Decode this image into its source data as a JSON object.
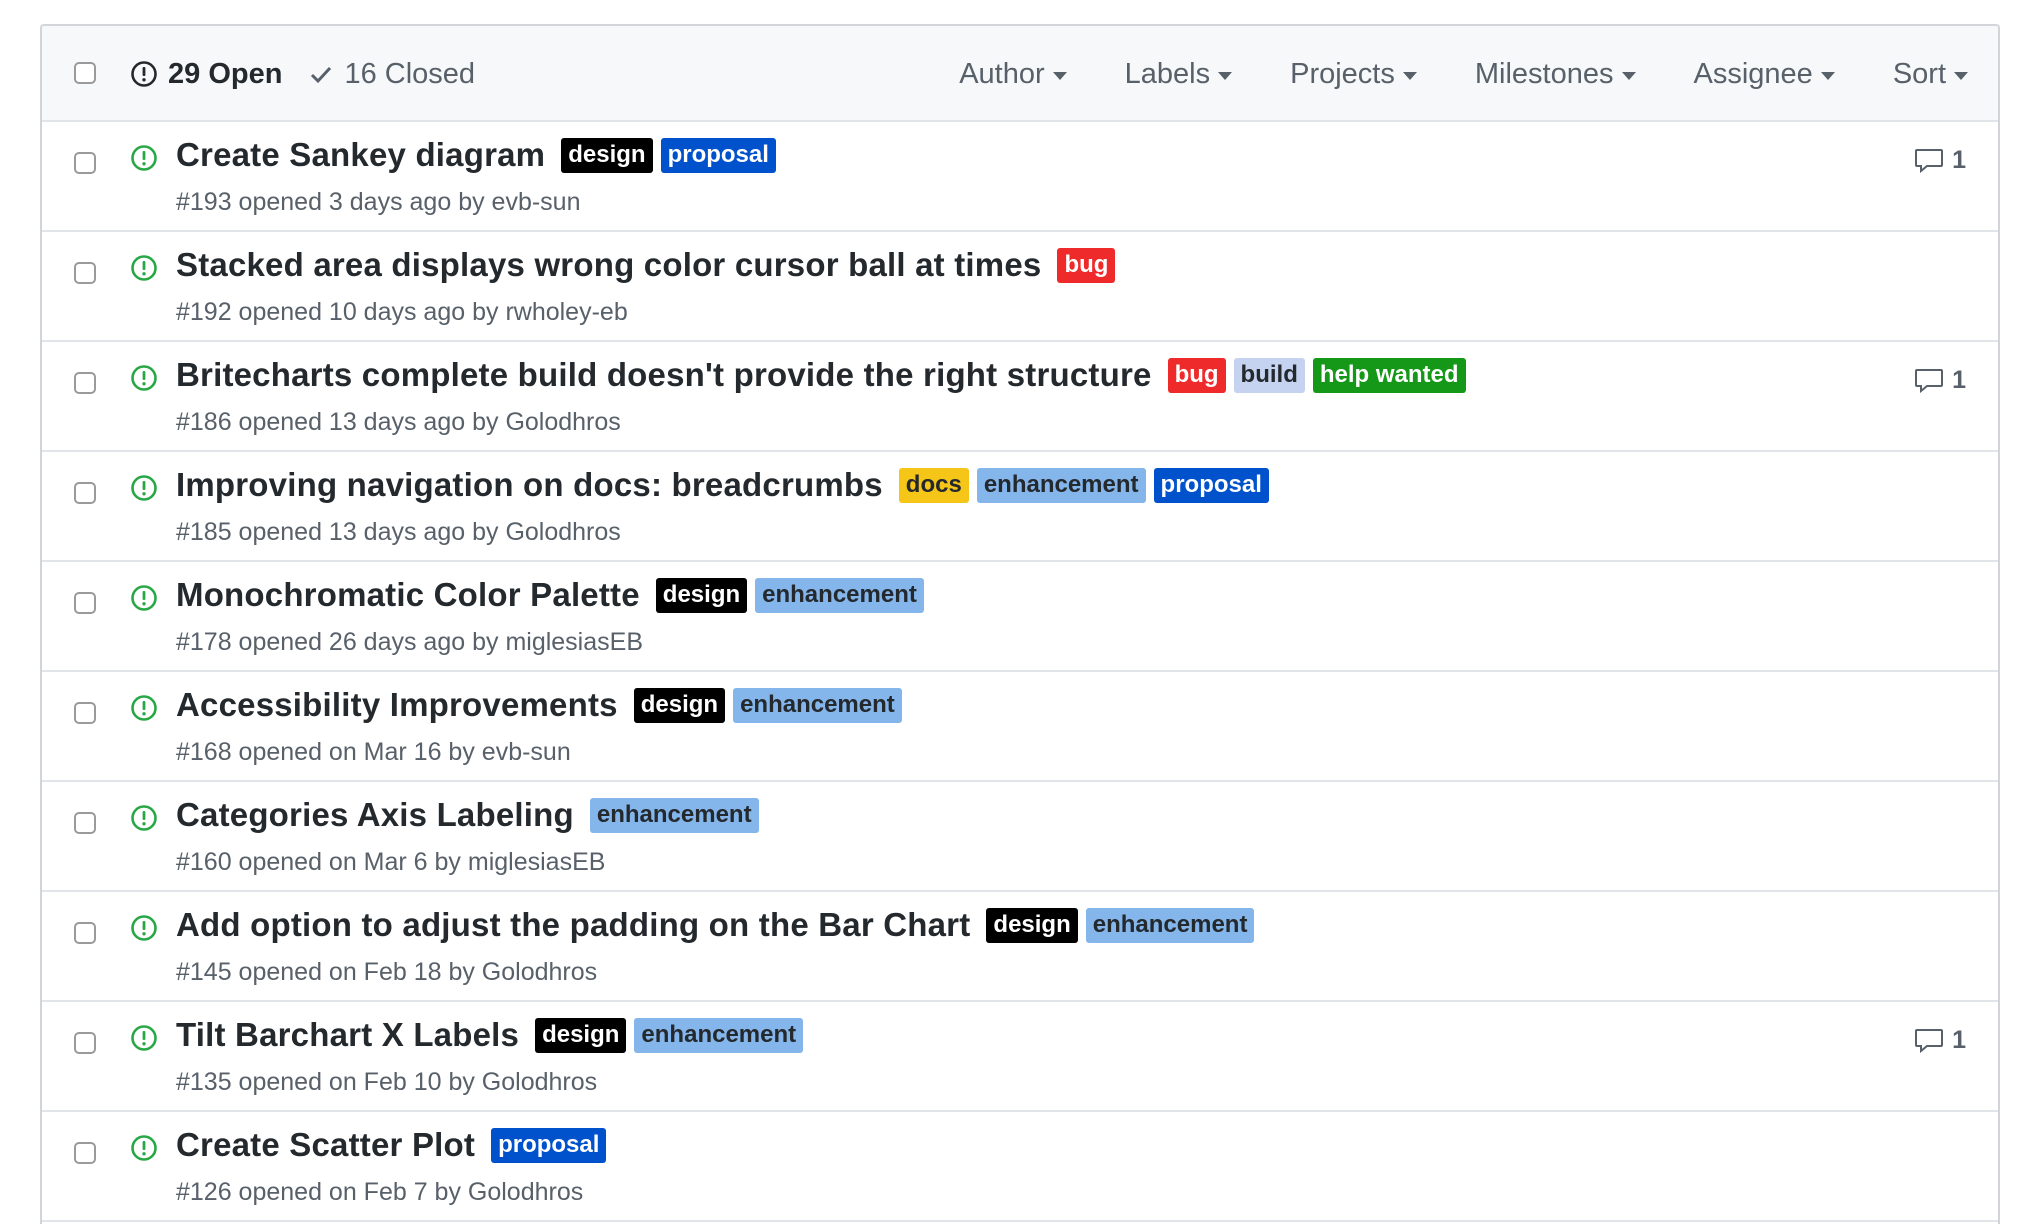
{
  "header": {
    "open_count": "29 Open",
    "closed_count": "16 Closed",
    "filters": [
      "Author",
      "Labels",
      "Projects",
      "Milestones",
      "Assignee",
      "Sort"
    ]
  },
  "label_colors": {
    "design": {
      "bg": "#000000",
      "fg": "#ffffff"
    },
    "proposal": {
      "bg": "#0052cc",
      "fg": "#ffffff"
    },
    "bug": {
      "bg": "#ee2a2a",
      "fg": "#ffffff"
    },
    "build": {
      "bg": "#c5d3f0",
      "fg": "#24292e"
    },
    "help wanted": {
      "bg": "#159818",
      "fg": "#ffffff"
    },
    "docs": {
      "bg": "#f5c518",
      "fg": "#24292e"
    },
    "enhancement": {
      "bg": "#84b6eb",
      "fg": "#24292e"
    }
  },
  "issues": [
    {
      "title": "Create Sankey diagram",
      "labels": [
        "design",
        "proposal"
      ],
      "meta": "#193 opened 3 days ago by evb-sun",
      "comments": "1"
    },
    {
      "title": "Stacked area displays wrong color cursor ball at times",
      "labels": [
        "bug"
      ],
      "meta": "#192 opened 10 days ago by rwholey-eb",
      "comments": ""
    },
    {
      "title": "Britecharts complete build doesn't provide the right structure",
      "labels": [
        "bug",
        "build",
        "help wanted"
      ],
      "meta": "#186 opened 13 days ago by Golodhros",
      "comments": "1"
    },
    {
      "title": "Improving navigation on docs: breadcrumbs",
      "labels": [
        "docs",
        "enhancement",
        "proposal"
      ],
      "meta": "#185 opened 13 days ago by Golodhros",
      "comments": ""
    },
    {
      "title": "Monochromatic Color Palette",
      "labels": [
        "design",
        "enhancement"
      ],
      "meta": "#178 opened 26 days ago by miglesiasEB",
      "comments": ""
    },
    {
      "title": "Accessibility Improvements",
      "labels": [
        "design",
        "enhancement"
      ],
      "meta": "#168 opened on Mar 16 by evb-sun",
      "comments": ""
    },
    {
      "title": "Categories Axis Labeling",
      "labels": [
        "enhancement"
      ],
      "meta": "#160 opened on Mar 6 by miglesiasEB",
      "comments": ""
    },
    {
      "title": "Add option to adjust the padding on the Bar Chart",
      "labels": [
        "design",
        "enhancement"
      ],
      "meta": "#145 opened on Feb 18 by Golodhros",
      "comments": ""
    },
    {
      "title": "Tilt Barchart X Labels",
      "labels": [
        "design",
        "enhancement"
      ],
      "meta": "#135 opened on Feb 10 by Golodhros",
      "comments": "1"
    },
    {
      "title": "Create Scatter Plot",
      "labels": [
        "proposal"
      ],
      "meta": "#126 opened on Feb 7 by Golodhros",
      "comments": ""
    }
  ]
}
